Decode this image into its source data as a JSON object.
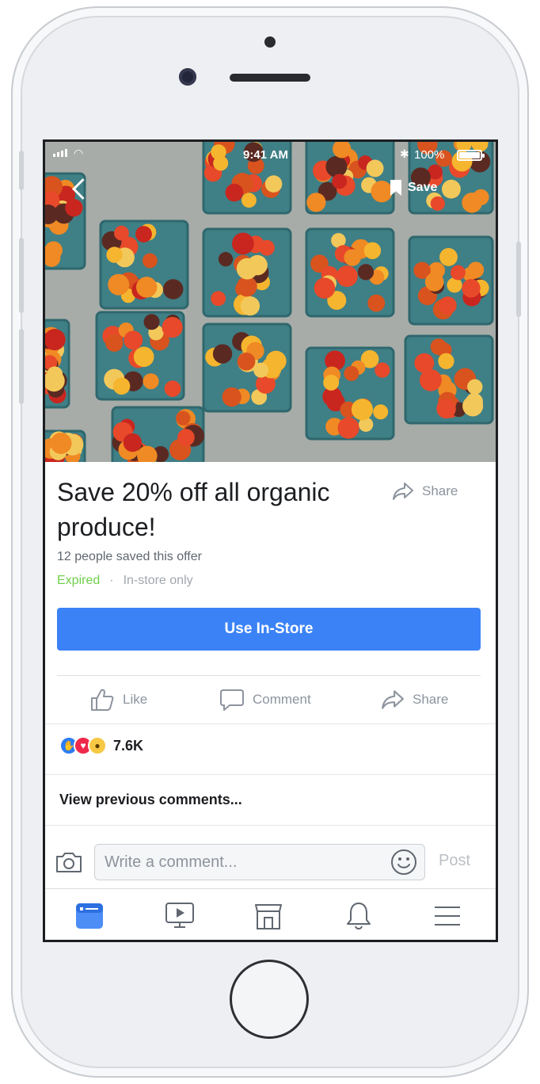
{
  "status_bar": {
    "time": "9:41 AM",
    "battery": "100%"
  },
  "header": {
    "save_label": "Save"
  },
  "offer": {
    "title": "Save 20% off all organic produce!",
    "share_label": "Share",
    "saved_count": "12 people saved this offer",
    "status": "Expired",
    "separator": "·",
    "availability": "In-store only",
    "cta_label": "Use In-Store"
  },
  "actions": {
    "like_label": "Like",
    "comment_label": "Comment",
    "share_label": "Share"
  },
  "reactions": {
    "count": "7.6K",
    "icons": [
      "like-icon",
      "love-icon",
      "wow-icon"
    ]
  },
  "comments": {
    "view_previous": "View previous comments...",
    "placeholder": "Write a comment...",
    "post_label": "Post"
  },
  "tabbar": {
    "items": [
      "news-feed-icon",
      "watch-icon",
      "marketplace-icon",
      "notifications-icon",
      "menu-icon"
    ],
    "active": "news-feed-icon"
  },
  "colors": {
    "accent": "#3b82f6",
    "expired": "#6fcf4a",
    "muted": "#8d949e"
  }
}
